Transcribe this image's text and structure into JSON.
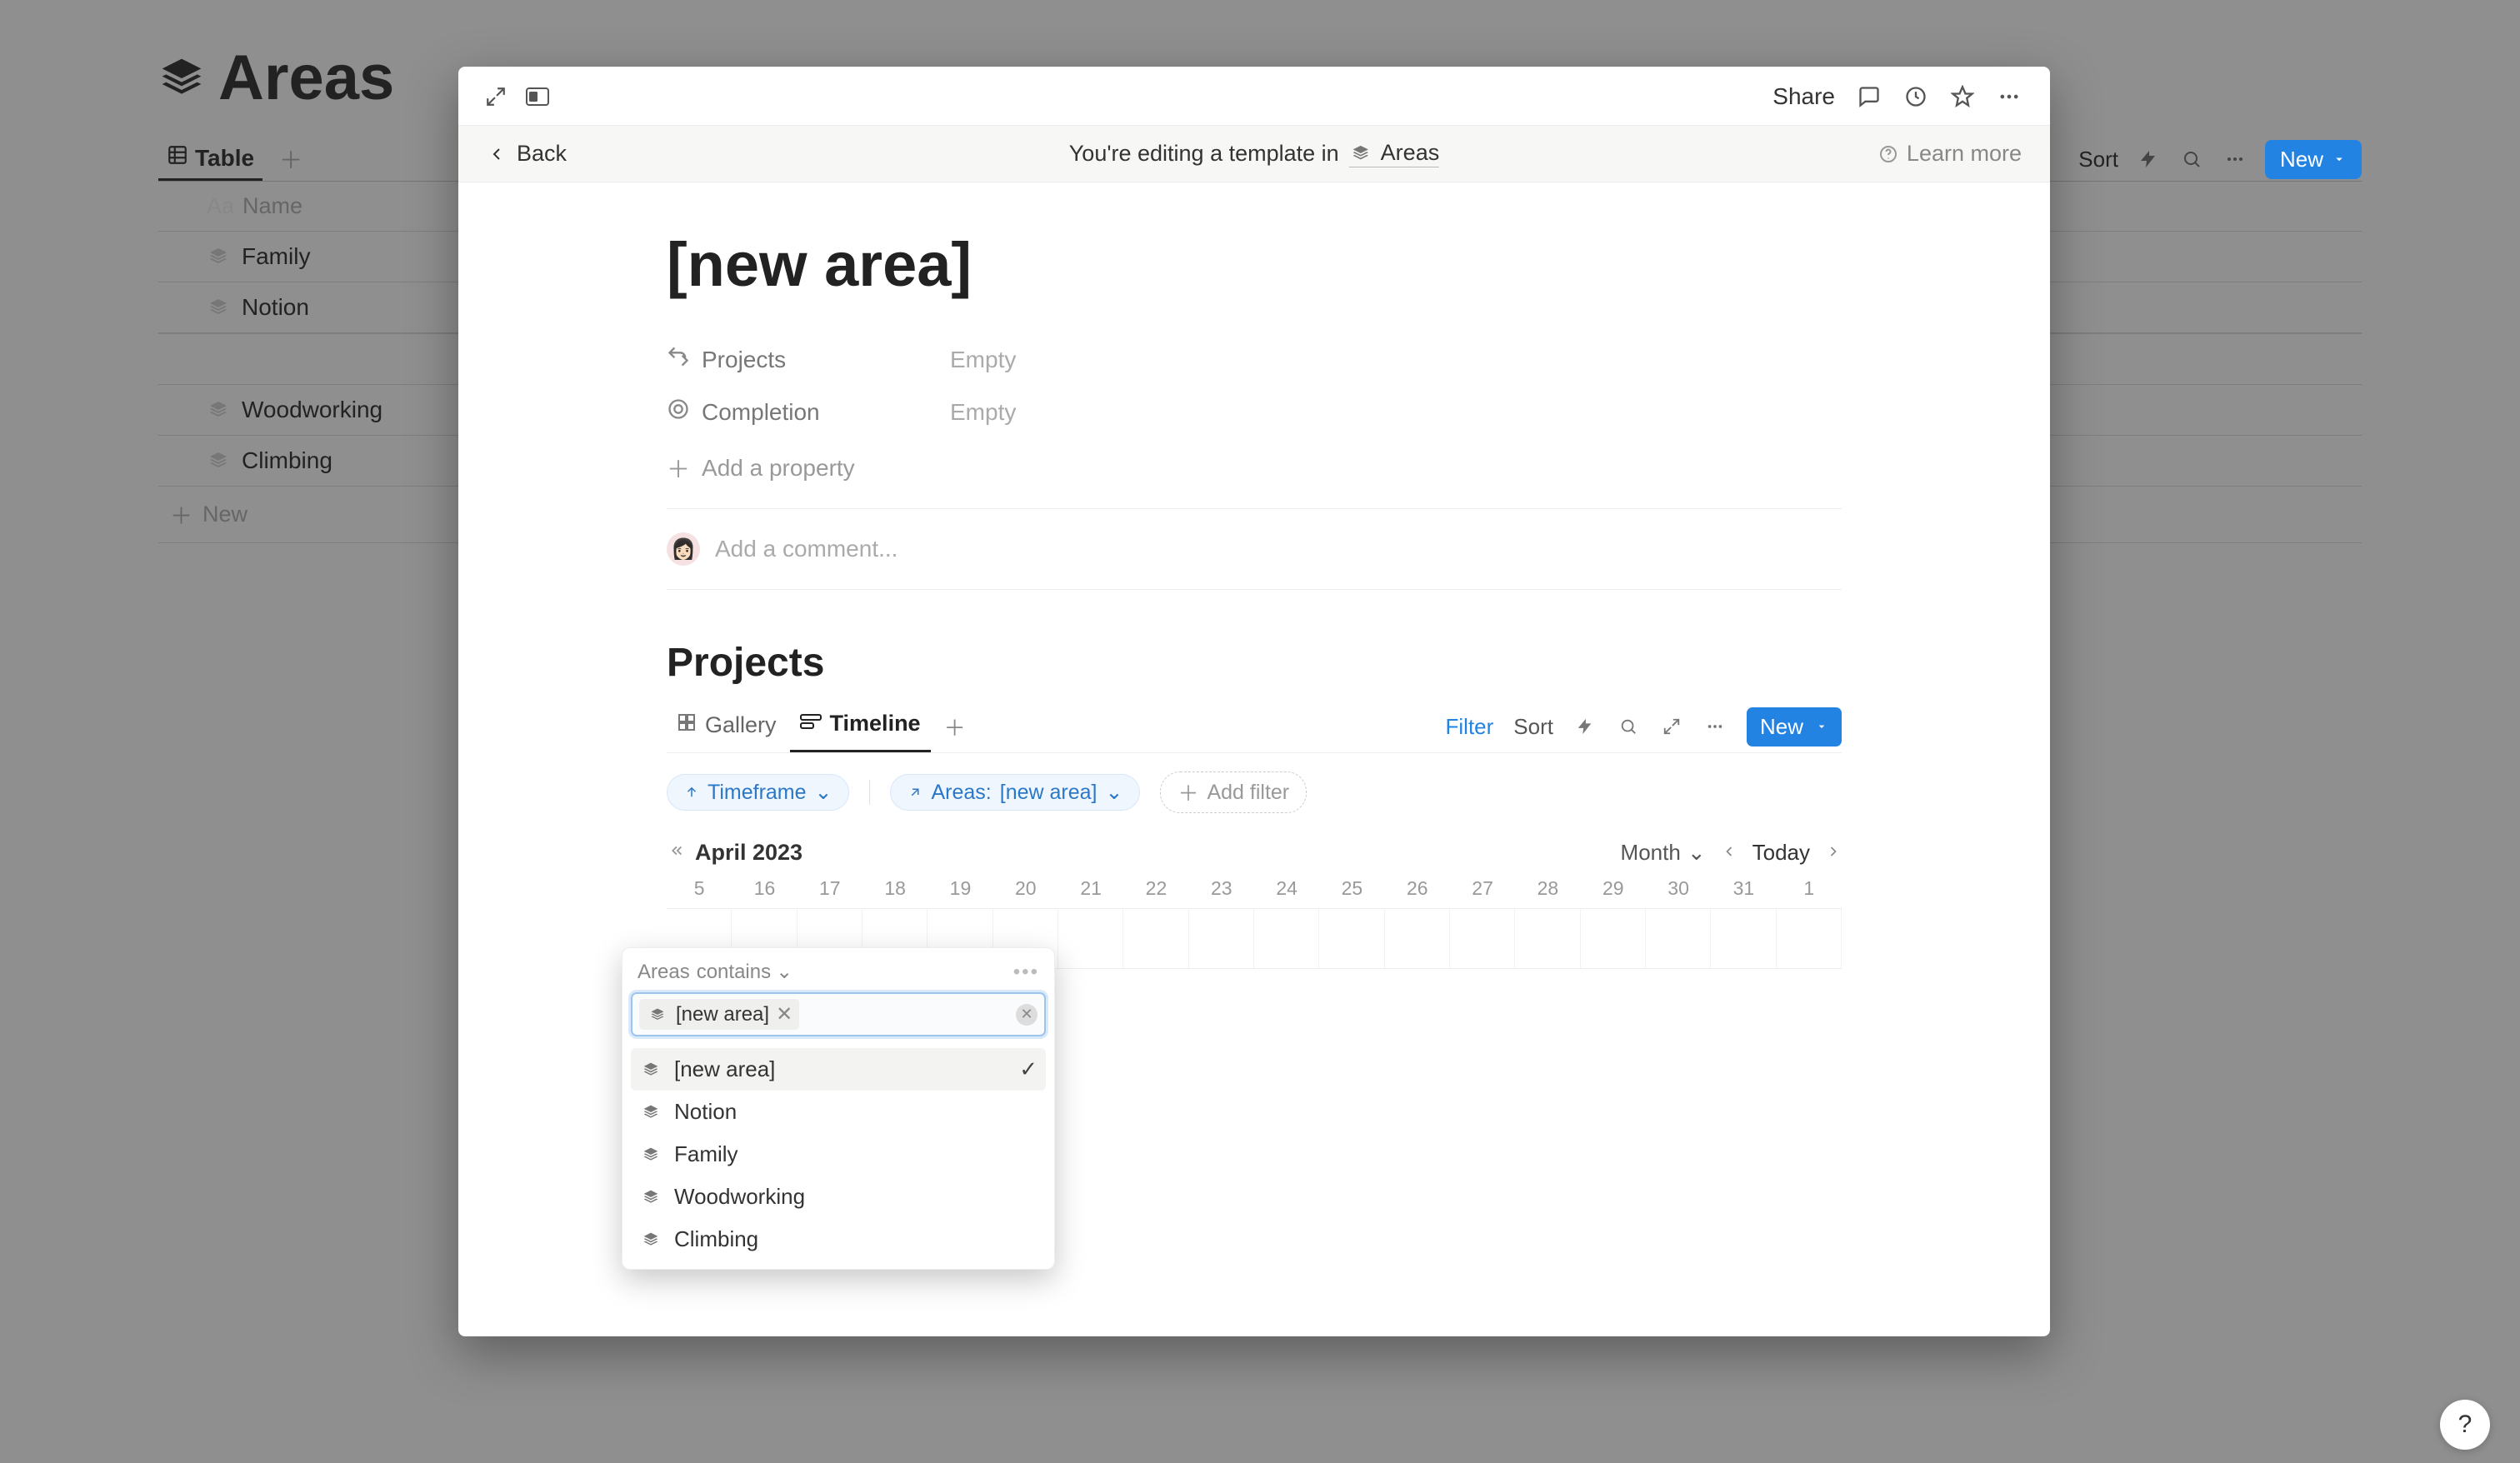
{
  "background": {
    "page_title": "Areas",
    "tab_label": "Table",
    "column_header": "Name",
    "rows": [
      "Family",
      "Notion",
      "Woodworking",
      "Climbing"
    ],
    "new_row_label": "New",
    "new_button_label": "New",
    "sort_label": "Sort",
    "question_mark": "?"
  },
  "modal": {
    "share_label": "Share",
    "back_label": "Back",
    "breadcrumb_prefix": "You're editing a template in",
    "breadcrumb_db": "Areas",
    "learn_more_label": "Learn more",
    "page_title": "[new area]",
    "properties": [
      {
        "name": "Projects",
        "value": "Empty"
      },
      {
        "name": "Completion",
        "value": "Empty"
      }
    ],
    "add_property_label": "Add a property",
    "comment_placeholder": "Add a comment...",
    "avatar_emoji": "👩🏻",
    "section_title": "Projects",
    "views": {
      "gallery": "Gallery",
      "timeline": "Timeline"
    },
    "view_actions": {
      "filter": "Filter",
      "sort": "Sort",
      "new": "New"
    },
    "filters": {
      "timeframe_label": "Timeframe",
      "areas_label": "Areas:",
      "areas_value": "[new area]",
      "add_filter_label": "Add filter"
    },
    "timeline": {
      "month_label": "April 2023",
      "month_selector": "Month",
      "today_label": "Today",
      "dates": [
        "5",
        "16",
        "17",
        "18",
        "19",
        "20",
        "21",
        "22",
        "23",
        "24",
        "25",
        "26",
        "27",
        "28",
        "29",
        "30",
        "31",
        "1"
      ],
      "new_label": "New"
    }
  },
  "popover": {
    "field_label": "Areas",
    "condition_label": "contains",
    "token": "[new area]",
    "options": [
      "[new area]",
      "Notion",
      "Family",
      "Woodworking",
      "Climbing"
    ],
    "selected_index": 0
  }
}
